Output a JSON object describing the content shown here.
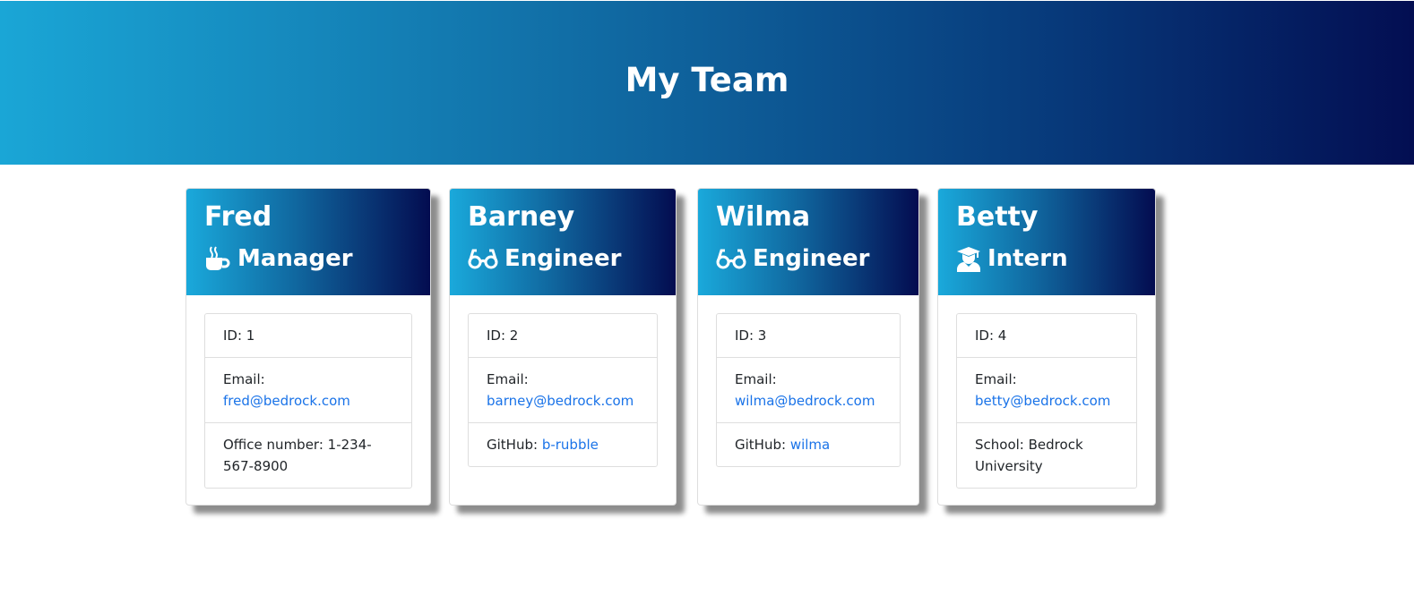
{
  "header": {
    "title": "My Team"
  },
  "team": [
    {
      "name": "Fred",
      "role": "Manager",
      "role_icon": "coffee-icon",
      "id_label": "ID: 1",
      "email_label": "Email:",
      "email": "fred@bedrock.com",
      "extra_label": "Office number:",
      "extra_value": "1-234-567-8900"
    },
    {
      "name": "Barney",
      "role": "Engineer",
      "role_icon": "glasses-icon",
      "id_label": "ID: 2",
      "email_label": "Email:",
      "email": "barney@bedrock.com",
      "extra_label": "GitHub:",
      "extra_value": "b-rubble"
    },
    {
      "name": "Wilma",
      "role": "Engineer",
      "role_icon": "glasses-icon",
      "id_label": "ID: 3",
      "email_label": "Email:",
      "email": "wilma@bedrock.com",
      "extra_label": "GitHub:",
      "extra_value": "wilma"
    },
    {
      "name": "Betty",
      "role": "Intern",
      "role_icon": "graduate-icon",
      "id_label": "ID: 4",
      "email_label": "Email:",
      "email": "betty@bedrock.com",
      "extra_label": "School:",
      "extra_value": "Bedrock University"
    }
  ],
  "colors": {
    "banner_start": "#1aa6d6",
    "banner_end": "#030e52",
    "link": "#1a73e8"
  }
}
